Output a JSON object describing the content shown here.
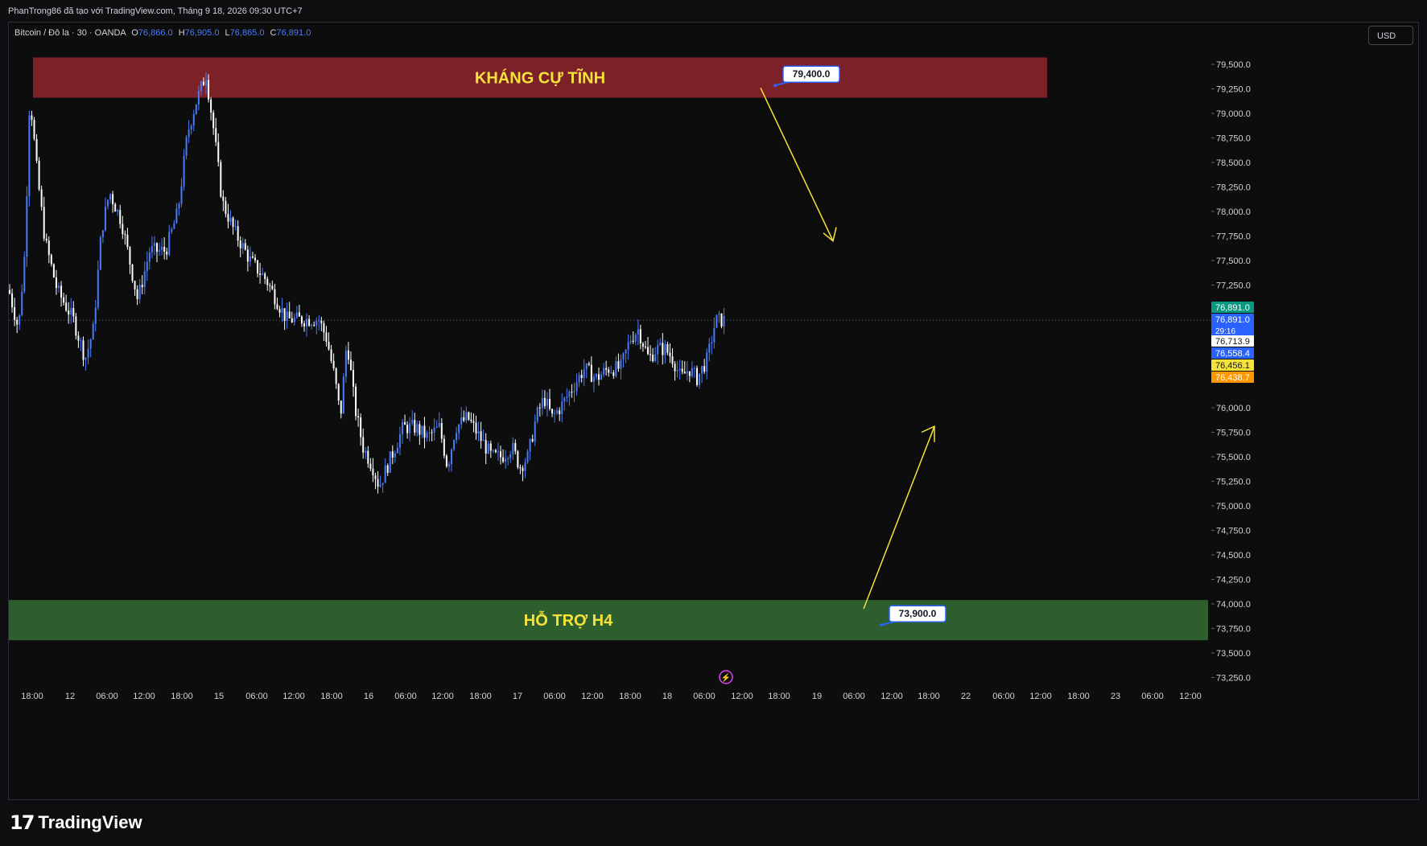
{
  "header": {
    "credit": "PhanTrong86 đã tạo với TradingView.com, Tháng 9 18, 2026 09:30 UTC+7"
  },
  "legend": {
    "symbol": "Bitcoin / Đô la · 30 · OANDA",
    "open_label": "O",
    "open": "76,866.0",
    "high_label": "H",
    "high": "76,905.0",
    "low_label": "L",
    "low": "76,865.0",
    "close_label": "C",
    "close": "76,891.0"
  },
  "currency_button": "USD",
  "footer": {
    "brand": "TradingView"
  },
  "colors": {
    "background": "#0d0d0d",
    "candle": "#4a7bf7",
    "candle_alt": "#ffffff",
    "resistance_zone": "#7d2129",
    "support_zone": "#2d5f2e",
    "zone_text": "#f5e33a",
    "arrow": "#f5e33a",
    "last_price_tag": "#089981"
  },
  "chart_data": {
    "type": "candlestick",
    "instrument": "Bitcoin / Đô la",
    "timeframe": "30",
    "ylim": [
      73100,
      79800
    ],
    "y_ticks": [
      "79,500.0",
      "79,250.0",
      "79,000.0",
      "78,750.0",
      "78,500.0",
      "78,250.0",
      "78,000.0",
      "77,750.0",
      "77,500.0",
      "77,250.0",
      "76,000.0",
      "75,750.0",
      "75,500.0",
      "75,250.0",
      "75,000.0",
      "74,750.0",
      "74,500.0",
      "74,250.0",
      "74,000.0",
      "73,750.0",
      "73,500.0",
      "73,250.0"
    ],
    "y_tick_values": [
      79500,
      79250,
      79000,
      78750,
      78500,
      78250,
      78000,
      77750,
      77500,
      77250,
      76000,
      75750,
      75500,
      75250,
      75000,
      74750,
      74500,
      74250,
      74000,
      73750,
      73500,
      73250
    ],
    "x_ticks": [
      "18:00",
      "12",
      "06:00",
      "12:00",
      "18:00",
      "15",
      "06:00",
      "12:00",
      "18:00",
      "16",
      "06:00",
      "12:00",
      "18:00",
      "17",
      "06:00",
      "12:00",
      "18:00",
      "18",
      "06:00",
      "12:00",
      "18:00",
      "19",
      "06:00",
      "12:00",
      "18:00",
      "22",
      "06:00",
      "12:00",
      "18:00",
      "23",
      "06:00",
      "12:00"
    ],
    "x_tick_pos": [
      39,
      86,
      132,
      178,
      225,
      271,
      318,
      364,
      411,
      457,
      503,
      549,
      596,
      642,
      688,
      735,
      782,
      828,
      874,
      921,
      967,
      1014,
      1060,
      1107,
      1153,
      1199,
      1246,
      1292,
      1339,
      1385,
      1431,
      1478
    ],
    "price_tags": [
      {
        "value": 76891.0,
        "label": "76,891.0",
        "color": "#089981"
      },
      {
        "value": 76891.0,
        "label": "76,891.0",
        "sub": "29:16",
        "color": "#2962ff"
      },
      {
        "value": 76713.9,
        "label": "76,713.9",
        "color": "#ffffff"
      },
      {
        "value": 76558.4,
        "label": "76,558.4",
        "color": "#2962ff"
      },
      {
        "value": 76456.1,
        "label": "76,456.1",
        "color": "#f5e33a"
      },
      {
        "value": 76438.7,
        "label": "76,438.7",
        "color": "#ff9800"
      }
    ],
    "last_price": 76891.0,
    "zones": [
      {
        "label": "KHÁNG CỰ TĨNH",
        "from": 79160,
        "to": 79570,
        "color": "#7d2129"
      },
      {
        "label": "HỖ TRỢ H4",
        "from": 73630,
        "to": 74040,
        "color": "#2d5f2e"
      }
    ],
    "price_notes": [
      {
        "label": "79,400.0",
        "value": 79400
      },
      {
        "label": "73,900.0",
        "value": 73900
      }
    ],
    "path_points": [
      [
        0,
        77200
      ],
      [
        12,
        76800
      ],
      [
        20,
        77600
      ],
      [
        26,
        79200
      ],
      [
        35,
        78400
      ],
      [
        45,
        77700
      ],
      [
        60,
        77200
      ],
      [
        80,
        76900
      ],
      [
        95,
        76500
      ],
      [
        105,
        76800
      ],
      [
        115,
        77800
      ],
      [
        125,
        78200
      ],
      [
        140,
        77900
      ],
      [
        160,
        77100
      ],
      [
        175,
        77600
      ],
      [
        195,
        77600
      ],
      [
        210,
        78000
      ],
      [
        222,
        78800
      ],
      [
        232,
        79100
      ],
      [
        245,
        79400
      ],
      [
        255,
        78800
      ],
      [
        265,
        78100
      ],
      [
        280,
        77800
      ],
      [
        300,
        77500
      ],
      [
        320,
        77300
      ],
      [
        345,
        76900
      ],
      [
        365,
        76900
      ],
      [
        385,
        76900
      ],
      [
        395,
        76700
      ],
      [
        405,
        76300
      ],
      [
        412,
        75900
      ],
      [
        420,
        76700
      ],
      [
        430,
        76000
      ],
      [
        440,
        75600
      ],
      [
        452,
        75400
      ],
      [
        460,
        75200
      ],
      [
        475,
        75500
      ],
      [
        490,
        75800
      ],
      [
        505,
        75800
      ],
      [
        520,
        75700
      ],
      [
        535,
        75800
      ],
      [
        545,
        75400
      ],
      [
        555,
        75800
      ],
      [
        570,
        75900
      ],
      [
        585,
        75700
      ],
      [
        600,
        75500
      ],
      [
        612,
        75500
      ],
      [
        625,
        75600
      ],
      [
        635,
        75400
      ],
      [
        645,
        75500
      ],
      [
        655,
        75900
      ],
      [
        665,
        76100
      ],
      [
        675,
        75900
      ],
      [
        685,
        76000
      ],
      [
        700,
        76200
      ],
      [
        715,
        76400
      ],
      [
        730,
        76300
      ],
      [
        745,
        76400
      ],
      [
        760,
        76400
      ],
      [
        772,
        76700
      ],
      [
        782,
        76800
      ],
      [
        795,
        76500
      ],
      [
        805,
        76600
      ],
      [
        815,
        76600
      ],
      [
        825,
        76500
      ],
      [
        835,
        76300
      ],
      [
        845,
        76400
      ],
      [
        855,
        76300
      ],
      [
        868,
        76500
      ],
      [
        878,
        76891
      ]
    ]
  }
}
